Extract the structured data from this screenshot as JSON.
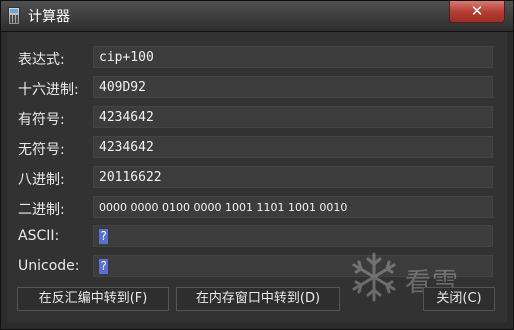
{
  "window": {
    "title": "计算器",
    "close_label": "✕"
  },
  "rows": [
    {
      "label": "表达式:",
      "value": "cip+100"
    },
    {
      "label": "十六进制:",
      "value": "409D92"
    },
    {
      "label": "有符号:",
      "value": "4234642"
    },
    {
      "label": "无符号:",
      "value": "4234642"
    },
    {
      "label": "八进制:",
      "value": "20116622"
    },
    {
      "label": "二进制:",
      "value": "0000 0000 0100 0000 1001 1101 1001 0010"
    },
    {
      "label": "ASCII:",
      "value": "?"
    },
    {
      "label": "Unicode:",
      "value": "?"
    }
  ],
  "buttons": {
    "goto_disasm": "在反汇编中转到(F)",
    "goto_dump": "在内存窗口中转到(D)",
    "close": "关闭(C)"
  },
  "watermark": {
    "text": "看雪",
    "icon": "snowflake-icon"
  }
}
